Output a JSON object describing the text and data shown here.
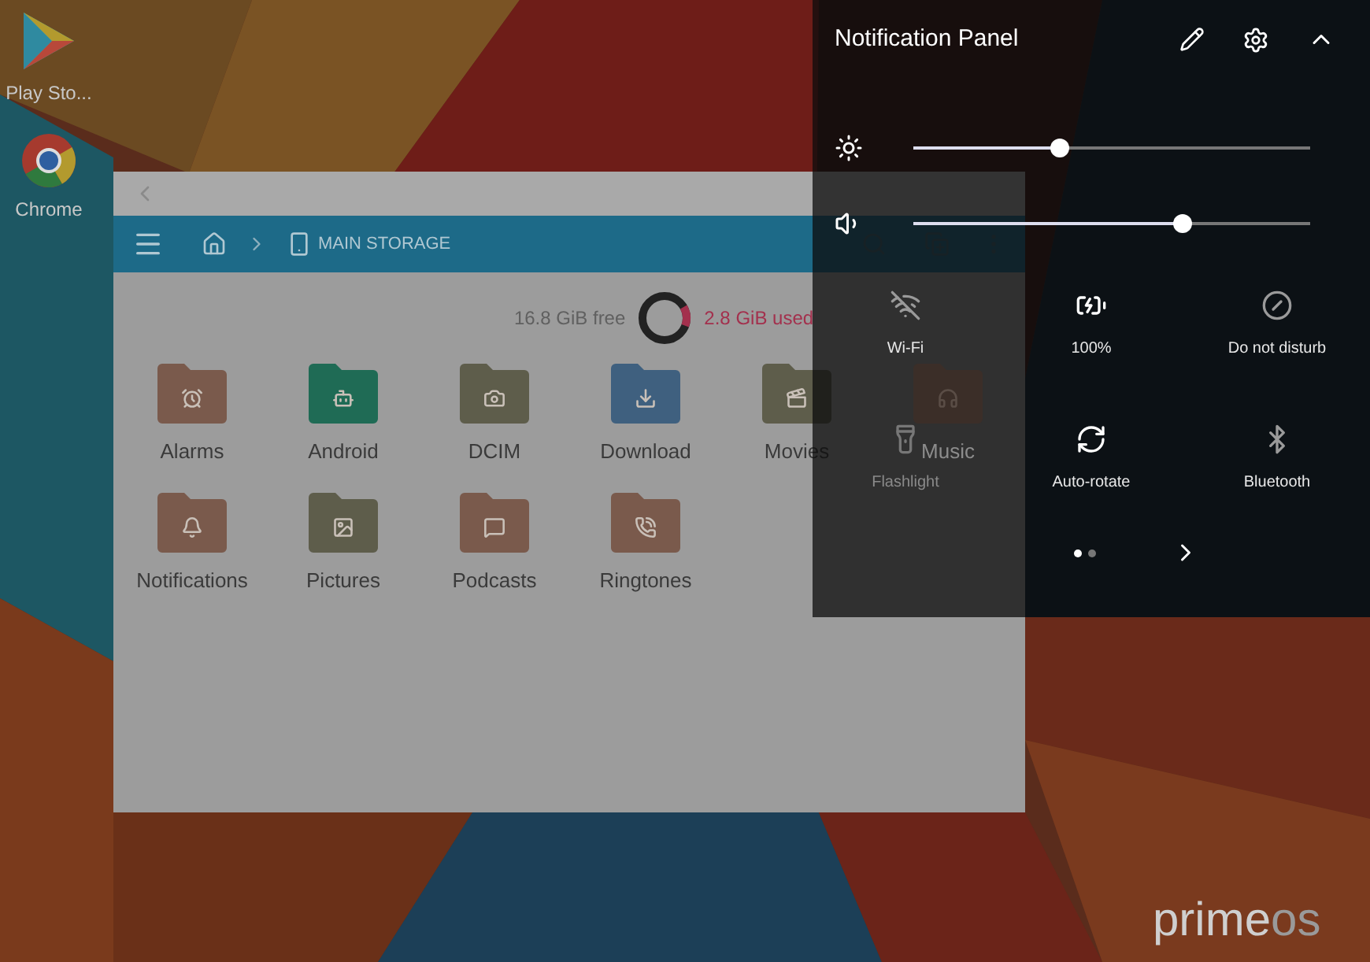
{
  "desktop_icons": [
    {
      "label": "Play Sto...",
      "kind": "play"
    },
    {
      "label": "Chrome",
      "kind": "chrome"
    }
  ],
  "file_manager": {
    "breadcrumb": "MAIN STORAGE",
    "storage": {
      "free": "16.8 GiB free",
      "used": "2.8 GiB used",
      "level": 0.14
    },
    "folders": [
      {
        "name": "Alarms",
        "kind": "alarm",
        "color": "#7a5a4c"
      },
      {
        "name": "Android",
        "kind": "android",
        "color": "#1f6b55"
      },
      {
        "name": "DCIM",
        "kind": "camera",
        "color": "#5e5d4b"
      },
      {
        "name": "Download",
        "kind": "download",
        "color": "#3f607f"
      },
      {
        "name": "Movies",
        "kind": "movie",
        "color": "#5e5d4b"
      },
      {
        "name": "Music",
        "kind": "music",
        "color": "#3b2e28",
        "dimmed": true
      },
      {
        "name": "Notifications",
        "kind": "bell",
        "color": "#7a5a4c"
      },
      {
        "name": "Pictures",
        "kind": "picture",
        "color": "#5e5d4b"
      },
      {
        "name": "Podcasts",
        "kind": "chat",
        "color": "#7a5a4c"
      },
      {
        "name": "Ringtones",
        "kind": "ring",
        "color": "#7a5a4c"
      }
    ]
  },
  "notification_panel": {
    "title": "Notification Panel",
    "sliders": [
      {
        "kind": "brightness",
        "level": 0.37
      },
      {
        "kind": "volume",
        "level": 0.68
      }
    ],
    "tiles": [
      {
        "label": "Wi-Fi",
        "kind": "wifi",
        "on": false,
        "disabled": false
      },
      {
        "label": "100%",
        "kind": "battery",
        "on": true,
        "disabled": false
      },
      {
        "label": "Do not disturb",
        "kind": "dnd",
        "on": false,
        "disabled": false
      },
      {
        "label": "Flashlight",
        "kind": "flashlight",
        "on": false,
        "disabled": true
      },
      {
        "label": "Auto-rotate",
        "kind": "rotate",
        "on": true,
        "disabled": false
      },
      {
        "label": "Bluetooth",
        "kind": "bluetooth",
        "on": false,
        "disabled": false
      }
    ],
    "pages": [
      {
        "selected": true
      },
      {
        "selected": false
      }
    ]
  },
  "logo": {
    "prime": "prime",
    "os": "os"
  }
}
